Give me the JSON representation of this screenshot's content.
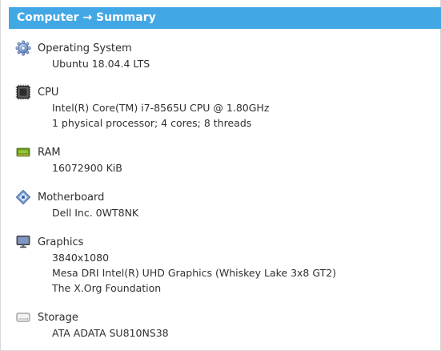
{
  "header": {
    "title": "Computer → Summary"
  },
  "sections": [
    {
      "title": "Operating System",
      "icon": "gear-icon",
      "values": [
        "Ubuntu 18.04.4 LTS"
      ]
    },
    {
      "title": "CPU",
      "icon": "cpu-icon",
      "values": [
        "Intel(R) Core(TM) i7-8565U CPU @ 1.80GHz",
        "1 physical processor; 4 cores; 8 threads"
      ]
    },
    {
      "title": "RAM",
      "icon": "memory-icon",
      "values": [
        "16072900 KiB"
      ]
    },
    {
      "title": "Motherboard",
      "icon": "motherboard-icon",
      "values": [
        "Dell Inc. 0WT8NK"
      ]
    },
    {
      "title": "Graphics",
      "icon": "monitor-icon",
      "values": [
        "3840x1080",
        "Mesa DRI Intel(R) UHD Graphics (Whiskey Lake 3x8 GT2)",
        "The X.Org Foundation"
      ]
    },
    {
      "title": "Storage",
      "icon": "drive-icon",
      "values": [
        "ATA ADATA SU810NS38"
      ]
    }
  ],
  "colors": {
    "header_bg": "#42a7e5",
    "header_text": "#ffffff",
    "text": "#2f2f2f"
  }
}
